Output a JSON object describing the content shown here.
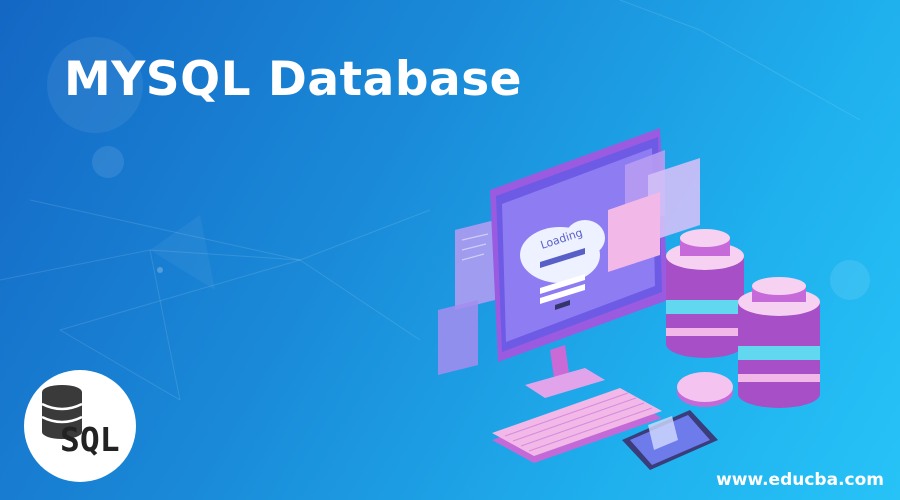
{
  "banner": {
    "title": "MYSQL Database",
    "badge_label": "SQL",
    "website": "www.educba.com",
    "screen_text": "Loading"
  },
  "icons": {
    "badge": "database-icon",
    "hero": "computer-database-illustration"
  },
  "colors": {
    "background_start": "#1467c4",
    "background_end": "#27c3f7",
    "title": "#ffffff",
    "accent_pink": "#f2b8e8",
    "accent_purple": "#8c6cf0"
  }
}
